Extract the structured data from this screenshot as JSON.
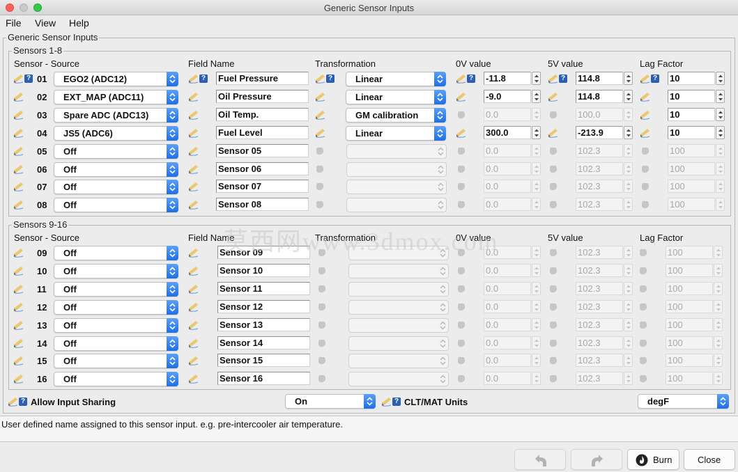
{
  "window": {
    "title": "Generic Sensor Inputs"
  },
  "menu": [
    "File",
    "View",
    "Help"
  ],
  "panel": {
    "title": "Generic Sensor Inputs"
  },
  "group1": {
    "title": "Sensors 1-8"
  },
  "group2": {
    "title": "Sensors 9-16"
  },
  "headers": {
    "source": "Sensor - Source",
    "field_name": "Field Name",
    "transformation": "Transformation",
    "v0": "0V value",
    "v5": "5V value",
    "lag": "Lag Factor"
  },
  "sensors": [
    {
      "num": "01",
      "source": "EGO2 (ADC12)",
      "name": "Fuel Pressure",
      "transform": "Linear",
      "v0": "-11.8",
      "v5": "114.8",
      "lag": "10",
      "enabled": true
    },
    {
      "num": "02",
      "source": "EXT_MAP (ADC11)",
      "name": "Oil Pressure",
      "transform": "Linear",
      "v0": "-9.0",
      "v5": "114.8",
      "lag": "10",
      "enabled": true
    },
    {
      "num": "03",
      "source": "Spare ADC (ADC13)",
      "name": "Oil Temp.",
      "transform": "GM calibration",
      "v0": "0.0",
      "v5": "100.0",
      "lag": "10",
      "enabled": true,
      "values_disabled": true
    },
    {
      "num": "04",
      "source": "JS5 (ADC6)",
      "name": "Fuel Level",
      "transform": "Linear",
      "v0": "300.0",
      "v5": "-213.9",
      "lag": "10",
      "enabled": true
    },
    {
      "num": "05",
      "source": "Off",
      "name": "Sensor 05",
      "transform": "",
      "v0": "0.0",
      "v5": "102.3",
      "lag": "100",
      "enabled": false
    },
    {
      "num": "06",
      "source": "Off",
      "name": "Sensor 06",
      "transform": "",
      "v0": "0.0",
      "v5": "102.3",
      "lag": "100",
      "enabled": false
    },
    {
      "num": "07",
      "source": "Off",
      "name": "Sensor 07",
      "transform": "",
      "v0": "0.0",
      "v5": "102.3",
      "lag": "100",
      "enabled": false
    },
    {
      "num": "08",
      "source": "Off",
      "name": "Sensor 08",
      "transform": "",
      "v0": "0.0",
      "v5": "102.3",
      "lag": "100",
      "enabled": false
    },
    {
      "num": "09",
      "source": "Off",
      "name": "Sensor 09",
      "transform": "",
      "v0": "0.0",
      "v5": "102.3",
      "lag": "100",
      "enabled": false
    },
    {
      "num": "10",
      "source": "Off",
      "name": "Sensor 10",
      "transform": "",
      "v0": "0.0",
      "v5": "102.3",
      "lag": "100",
      "enabled": false
    },
    {
      "num": "11",
      "source": "Off",
      "name": "Sensor 11",
      "transform": "",
      "v0": "0.0",
      "v5": "102.3",
      "lag": "100",
      "enabled": false
    },
    {
      "num": "12",
      "source": "Off",
      "name": "Sensor 12",
      "transform": "",
      "v0": "0.0",
      "v5": "102.3",
      "lag": "100",
      "enabled": false
    },
    {
      "num": "13",
      "source": "Off",
      "name": "Sensor 13",
      "transform": "",
      "v0": "0.0",
      "v5": "102.3",
      "lag": "100",
      "enabled": false
    },
    {
      "num": "14",
      "source": "Off",
      "name": "Sensor 14",
      "transform": "",
      "v0": "0.0",
      "v5": "102.3",
      "lag": "100",
      "enabled": false
    },
    {
      "num": "15",
      "source": "Off",
      "name": "Sensor 15",
      "transform": "",
      "v0": "0.0",
      "v5": "102.3",
      "lag": "100",
      "enabled": false
    },
    {
      "num": "16",
      "source": "Off",
      "name": "Sensor 16",
      "transform": "",
      "v0": "0.0",
      "v5": "102.3",
      "lag": "100",
      "enabled": false
    }
  ],
  "bottom": {
    "sharing_label": "Allow Input Sharing",
    "sharing_value": "On",
    "units_label": "CLT/MAT Units",
    "units_value": "degF"
  },
  "status": "User defined name assigned to this sensor input. e.g. pre-intercooler air temperature.",
  "buttons": {
    "burn": "Burn",
    "close": "Close"
  },
  "watermark": "莫西网www.3dmox.com",
  "icons": [
    "pencil-icon",
    "help-icon",
    "chevron-updown-icon",
    "undo-icon",
    "redo-icon",
    "flame-icon"
  ],
  "colors": {
    "accent": "#1f6fe5",
    "help": "#2b5fb4"
  }
}
